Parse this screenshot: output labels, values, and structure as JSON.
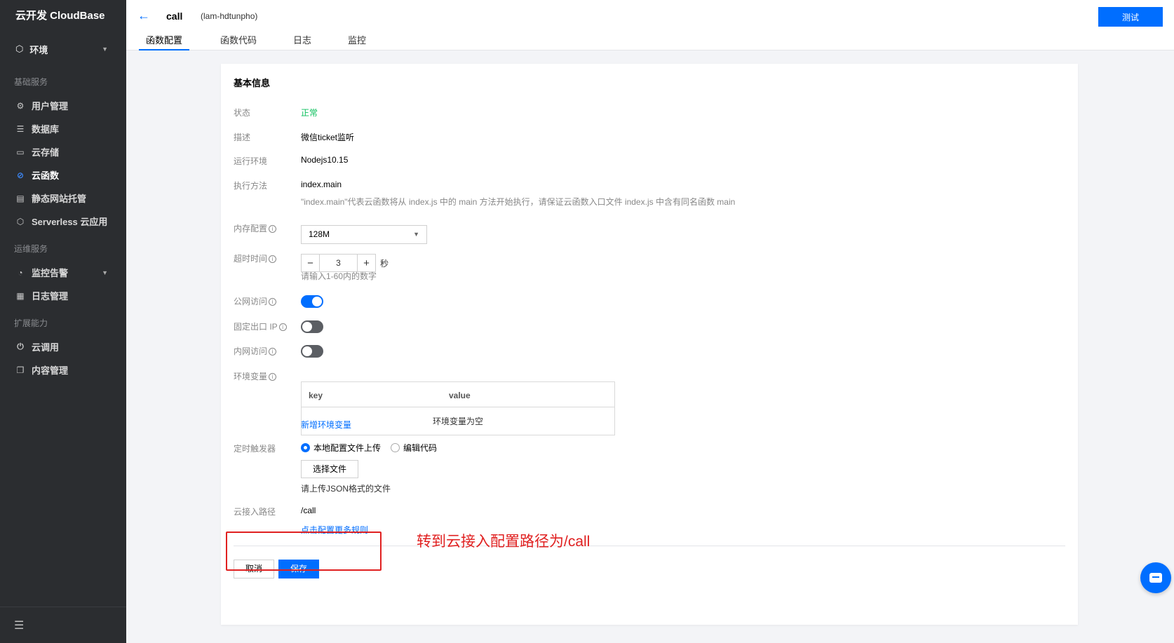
{
  "sidebar": {
    "brand": "云开发 CloudBase",
    "env_label": "环境",
    "groups": [
      {
        "title": "基础服务",
        "items": [
          {
            "label": "用户管理"
          },
          {
            "label": "数据库"
          },
          {
            "label": "云存储"
          },
          {
            "label": "云函数"
          },
          {
            "label": "静态网站托管"
          },
          {
            "label": "Serverless 云应用"
          }
        ]
      },
      {
        "title": "运维服务",
        "items": [
          {
            "label": "监控告警"
          },
          {
            "label": "日志管理"
          }
        ]
      },
      {
        "title": "扩展能力",
        "items": [
          {
            "label": "云调用"
          },
          {
            "label": "内容管理"
          }
        ]
      }
    ]
  },
  "header": {
    "function_name": "call",
    "function_id": "(lam-hdtunpho)",
    "test_button": "测试",
    "tabs": [
      {
        "label": "函数配置"
      },
      {
        "label": "函数代码"
      },
      {
        "label": "日志"
      },
      {
        "label": "监控"
      }
    ]
  },
  "card": {
    "title": "基本信息",
    "status_label": "状态",
    "status_value": "正常",
    "desc_label": "描述",
    "desc_value": "微信ticket监听",
    "runtime_label": "运行环境",
    "runtime_value": "Nodejs10.15",
    "handler_label": "执行方法",
    "handler_value": "index.main",
    "handler_hint": "\"index.main\"代表云函数将从 index.js 中的 main 方法开始执行，请保证云函数入口文件 index.js 中含有同名函数 main",
    "memory_label": "内存配置",
    "memory_value": "128M",
    "timeout_label": "超时时间",
    "timeout_value": "3",
    "timeout_unit": "秒",
    "timeout_hint": "请输入1-60内的数字",
    "public_access_label": "公网访问",
    "fixed_ip_label": "固定出口 IP",
    "private_access_label": "内网访问",
    "env_vars_label": "环境变量",
    "env_vars_key_header": "key",
    "env_vars_value_header": "value",
    "env_vars_empty": "环境变量为空",
    "add_env_var_link": "新增环境变量",
    "trigger_label": "定时触发器",
    "trigger_option_local": "本地配置文件上传",
    "trigger_option_edit": "编辑代码",
    "choose_file_button": "选择文件",
    "upload_hint": "请上传JSON格式的文件",
    "cloud_path_label": "云接入路径",
    "cloud_path_value": "/call",
    "more_rules_link": "点击配置更多规则",
    "cancel_button": "取消",
    "save_button": "保存"
  },
  "toggles": {
    "public_access": true,
    "fixed_ip": false,
    "private_access": false
  },
  "annotation": "转到云接入配置路径为/call",
  "colors": {
    "accent": "#006eff",
    "sidebar_bg": "#2b2d30",
    "success": "#0abf5b",
    "annotation": "#e02020"
  }
}
